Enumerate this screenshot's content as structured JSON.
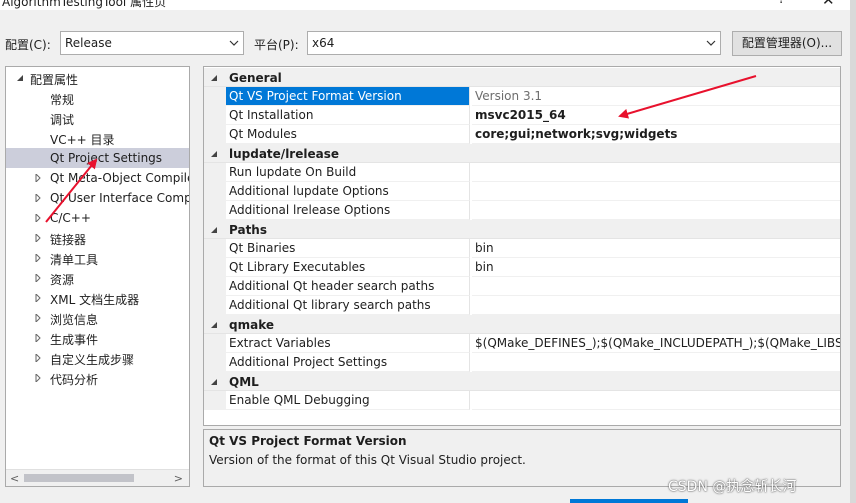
{
  "window": {
    "title": "AlgorithmTestingTool 属性页",
    "help_glyph": "?",
    "close_glyph": "✕"
  },
  "toolbar": {
    "config_label": "配置(C):",
    "config_value": "Release",
    "platform_label": "平台(P):",
    "platform_value": "x64",
    "config_manager_label": "配置管理器(O)..."
  },
  "tree": {
    "root": "配置属性",
    "items": [
      {
        "label": "常规",
        "expandable": false
      },
      {
        "label": "调试",
        "expandable": false
      },
      {
        "label": "VC++ 目录",
        "expandable": false
      },
      {
        "label": "Qt Project Settings",
        "expandable": false,
        "selected": true
      },
      {
        "label": "Qt Meta-Object Compile",
        "expandable": true
      },
      {
        "label": "Qt User Interface Comp",
        "expandable": true
      },
      {
        "label": "C/C++",
        "expandable": true
      },
      {
        "label": "链接器",
        "expandable": true
      },
      {
        "label": "清单工具",
        "expandable": true
      },
      {
        "label": "资源",
        "expandable": true
      },
      {
        "label": "XML 文档生成器",
        "expandable": true
      },
      {
        "label": "浏览信息",
        "expandable": true
      },
      {
        "label": "生成事件",
        "expandable": true
      },
      {
        "label": "自定义生成步骤",
        "expandable": true
      },
      {
        "label": "代码分析",
        "expandable": true
      }
    ]
  },
  "grid": {
    "rows": [
      {
        "type": "category",
        "label": "General"
      },
      {
        "type": "prop",
        "name": "Qt VS Project Format Version",
        "value": "Version 3.1",
        "selected": true,
        "style": "gray"
      },
      {
        "type": "prop",
        "name": "Qt Installation",
        "value": "msvc2015_64",
        "style": "bold"
      },
      {
        "type": "prop",
        "name": "Qt Modules",
        "value": "core;gui;network;svg;widgets",
        "style": "bold"
      },
      {
        "type": "category",
        "label": "lupdate/lrelease"
      },
      {
        "type": "prop",
        "name": "Run lupdate On Build",
        "value": ""
      },
      {
        "type": "prop",
        "name": "Additional lupdate Options",
        "value": ""
      },
      {
        "type": "prop",
        "name": "Additional lrelease Options",
        "value": ""
      },
      {
        "type": "category",
        "label": "Paths"
      },
      {
        "type": "prop",
        "name": "Qt Binaries",
        "value": "bin"
      },
      {
        "type": "prop",
        "name": "Qt Library Executables",
        "value": "bin"
      },
      {
        "type": "prop",
        "name": "Additional Qt header search paths",
        "value": ""
      },
      {
        "type": "prop",
        "name": "Additional Qt library search paths",
        "value": ""
      },
      {
        "type": "category",
        "label": "qmake"
      },
      {
        "type": "prop",
        "name": "Extract Variables",
        "value": "$(QMake_DEFINES_);$(QMake_INCLUDEPATH_);$(QMake_LIBS_)"
      },
      {
        "type": "prop",
        "name": "Additional Project Settings",
        "value": ""
      },
      {
        "type": "category",
        "label": "QML"
      },
      {
        "type": "prop",
        "name": "Enable QML Debugging",
        "value": ""
      }
    ]
  },
  "description": {
    "title": "Qt VS Project Format Version",
    "text": "Version of the format of this Qt Visual Studio project."
  },
  "watermark": "CSDN @执念斩长河",
  "colors": {
    "selection": "#0078d7",
    "tree_selection": "#cccedb",
    "annotation_arrow": "#e8112d"
  }
}
